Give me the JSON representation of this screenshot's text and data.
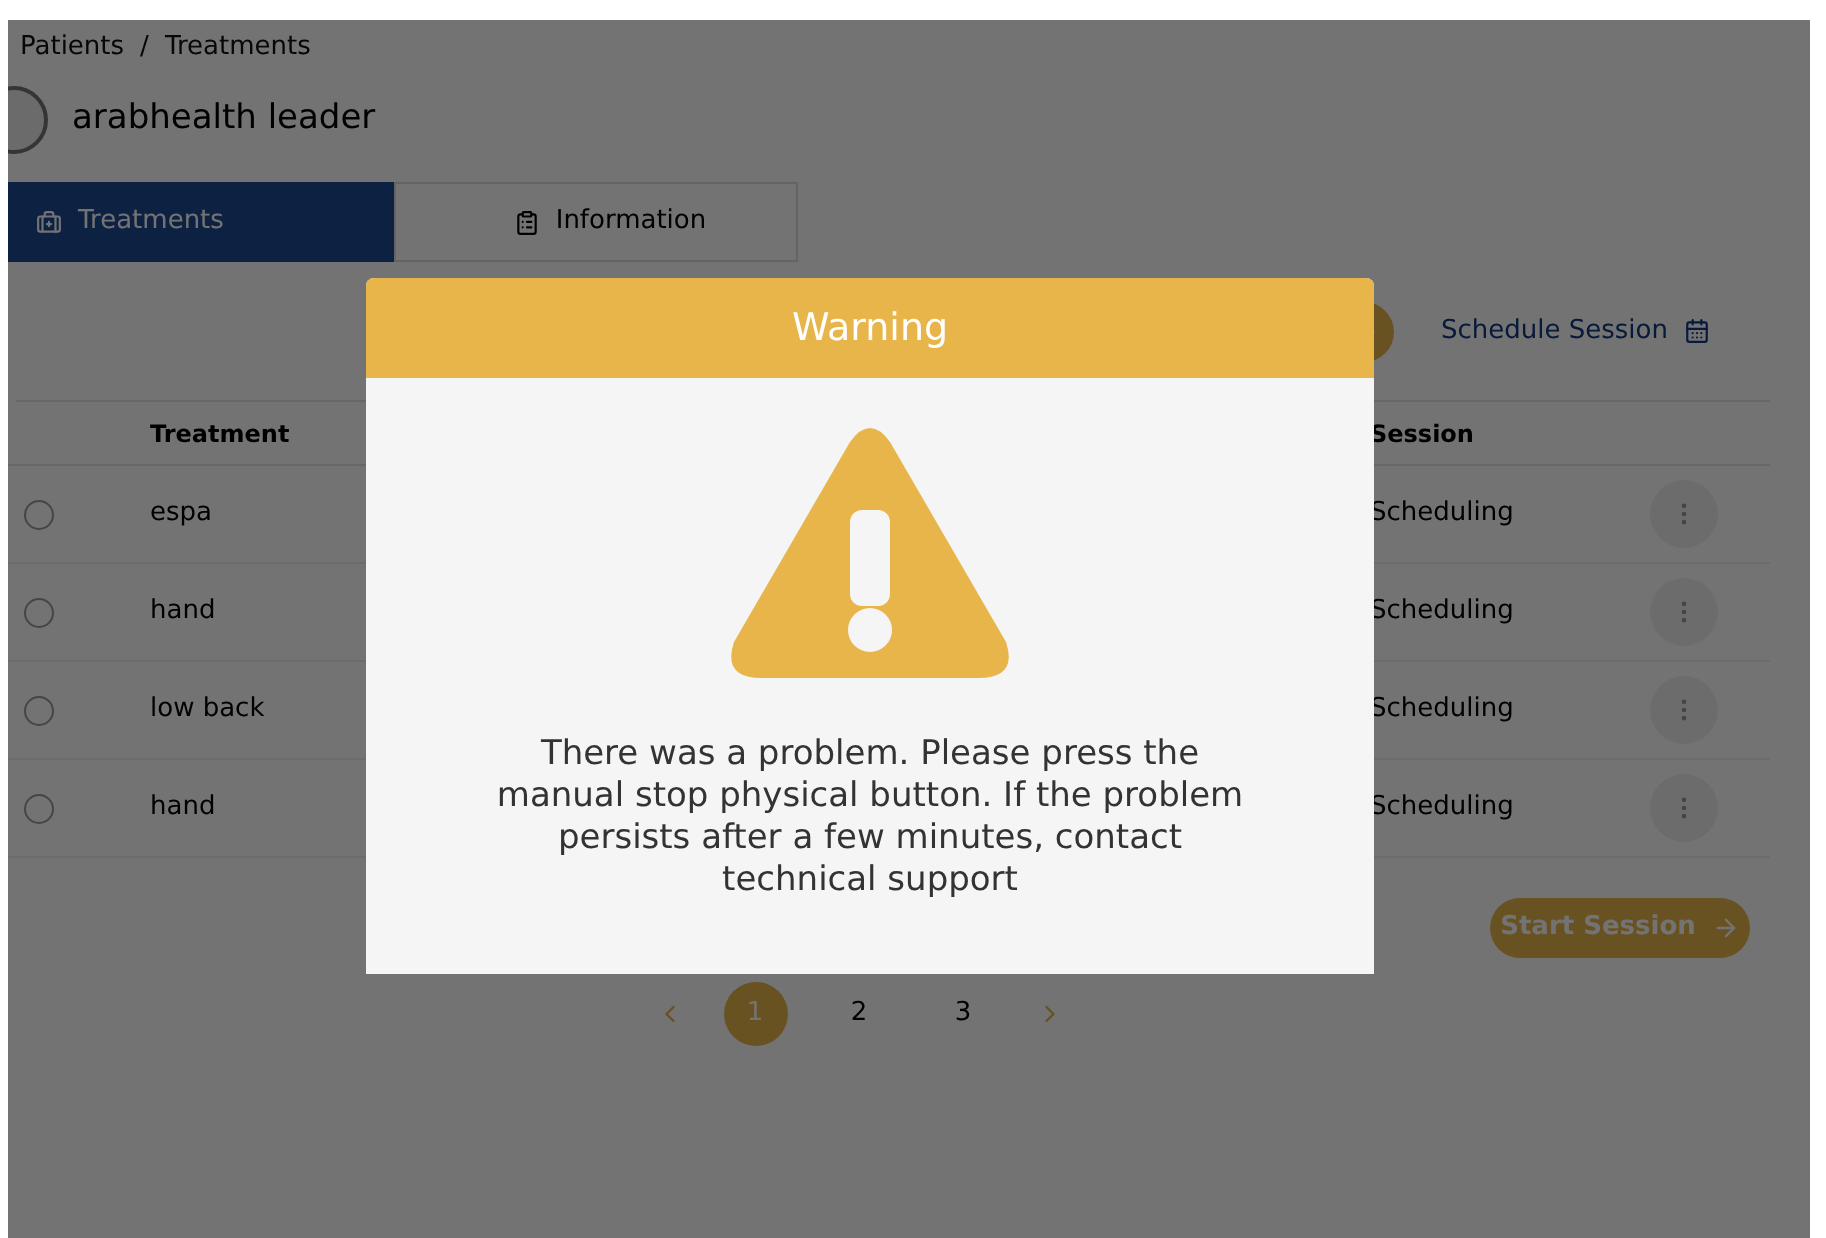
{
  "breadcrumb": {
    "items": [
      "Patients",
      "Treatments"
    ],
    "separator": "/"
  },
  "patient": {
    "name": "arabhealth leader"
  },
  "tabs": [
    {
      "label": "Treatments",
      "selected": true
    },
    {
      "label": "Information",
      "selected": false
    }
  ],
  "toolbar": {
    "schedule_link": "Schedule Session"
  },
  "table": {
    "columns": [
      "Treatment",
      "Session"
    ],
    "rows": [
      {
        "selected": false,
        "treatment": "espa",
        "session": "Scheduling"
      },
      {
        "selected": false,
        "treatment": "hand",
        "session": "Scheduling"
      },
      {
        "selected": false,
        "treatment": "low back",
        "session": "Scheduling"
      },
      {
        "selected": false,
        "treatment": "hand",
        "session": "Scheduling"
      }
    ]
  },
  "start_button": {
    "label": "Start Session"
  },
  "pagination": {
    "pages": [
      {
        "label": "1",
        "selected": true
      },
      {
        "label": "2",
        "selected": false
      },
      {
        "label": "3",
        "selected": false
      }
    ]
  },
  "modal": {
    "title": "Warning",
    "message": "There was a problem. Please press the manual stop physical button. If the problem persists after a few minutes, contact technical support"
  }
}
